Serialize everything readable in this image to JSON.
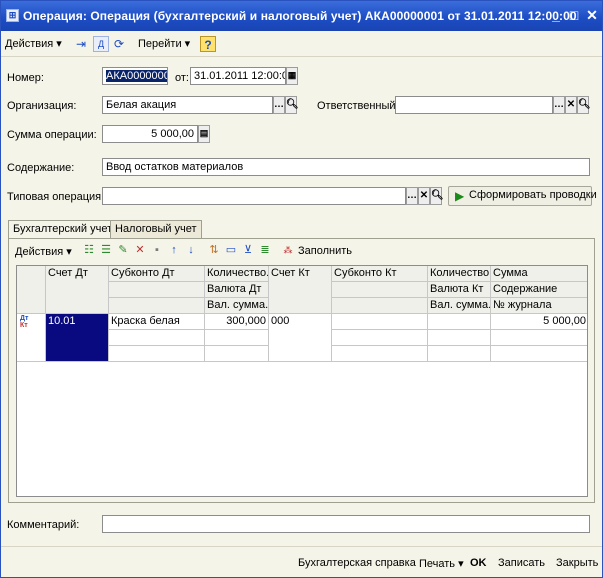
{
  "window": {
    "title": "Операция: Операция (бухгалтерский и налоговый учет) АКА00000001 от 31.01.2011 12:00:00",
    "minimize_glyph": "_",
    "maximize_glyph": "□",
    "close_glyph": "✕"
  },
  "menubar": {
    "actions_label": "Действия ▾",
    "goto_label": "Перейти ▾",
    "help_glyph": "?"
  },
  "form": {
    "number_label": "Номер:",
    "number_value": "АКА00000001",
    "date_label": "от:",
    "date_value": "31.01.2011 12:00:00",
    "org_label": "Организация:",
    "org_value": "Белая акация",
    "responsible_label": "Ответственный:",
    "responsible_value": "",
    "amount_label": "Сумма операции:",
    "amount_value": "5 000,00",
    "content_label": "Содержание:",
    "content_value": "Ввод остатков материалов",
    "typical_label": "Типовая операция:",
    "typical_value": "",
    "generate_button": "Сформировать проводки",
    "comment_label": "Комментарий:",
    "comment_value": ""
  },
  "tabs": [
    {
      "label": "Бухгалтерский учет"
    },
    {
      "label": "Налоговый учет"
    }
  ],
  "grid_toolbar": {
    "actions_label": "Действия ▾",
    "fill_label": "Заполнить"
  },
  "grid": {
    "headers": {
      "debit_account": "Счет Дт",
      "debit_subconto": "Субконто Дт",
      "debit_qty": "Количество...",
      "debit_currency": "Валюта Дт",
      "debit_cur_amount": "Вал. сумма...",
      "credit_account": "Счет Кт",
      "credit_subconto": "Субконто Кт",
      "credit_qty": "Количество...",
      "credit_currency": "Валюта Кт",
      "credit_cur_amount": "Вал. сумма...",
      "sum": "Сумма",
      "content": "Содержание",
      "journal": "№ журнала"
    },
    "row_icon_top": "Дт",
    "row_icon_bottom": "Кт",
    "rows": [
      {
        "debit_account": "10.01",
        "debit_subconto": "Краска белая",
        "debit_qty": "300,000",
        "credit_account": "000",
        "sum": "5 000,00"
      }
    ]
  },
  "statusbar": {
    "report_label": "Бухгалтерская справка",
    "print_label": "Печать ▾",
    "ok_label": "OK",
    "save_label": "Записать",
    "close_label": "Закрыть"
  },
  "colors": {
    "title_bar": "#1c4cc4",
    "selected_cell": "#0a0a80",
    "generate_arrow": "#1b8a1b"
  }
}
